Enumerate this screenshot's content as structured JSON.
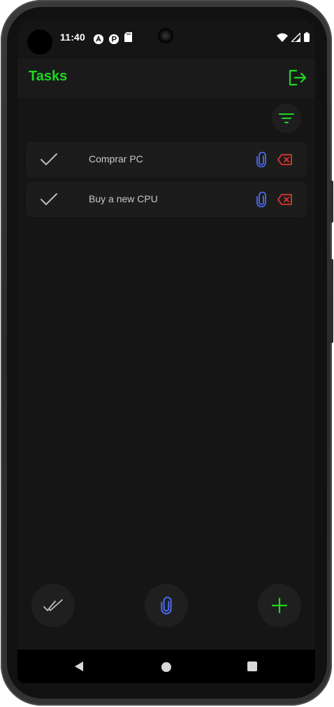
{
  "status_bar": {
    "time": "11:40",
    "left_icons": [
      "a-notification-icon",
      "p-notification-icon",
      "sd-card-icon"
    ],
    "right_icons": [
      "wifi-icon",
      "signal-icon",
      "battery-icon"
    ]
  },
  "app_bar": {
    "title": "Tasks",
    "action_icon": "logout-icon"
  },
  "filter": {
    "icon": "filter-icon"
  },
  "tasks": [
    {
      "title": "Comprar PC",
      "done": true
    },
    {
      "title": "Buy a new CPU",
      "done": true
    }
  ],
  "fabs": {
    "left_icon": "double-check-icon",
    "center_icon": "paperclip-icon",
    "right_icon": "add-icon"
  },
  "nav_bar": {
    "buttons": [
      "back",
      "home",
      "recents"
    ]
  },
  "colors": {
    "accent": "#1fd81f",
    "attach": "#4a6cf0",
    "delete": "#e0362c",
    "background": "#151516",
    "surface": "#1c1c1d",
    "text": "#c9c9c9"
  }
}
